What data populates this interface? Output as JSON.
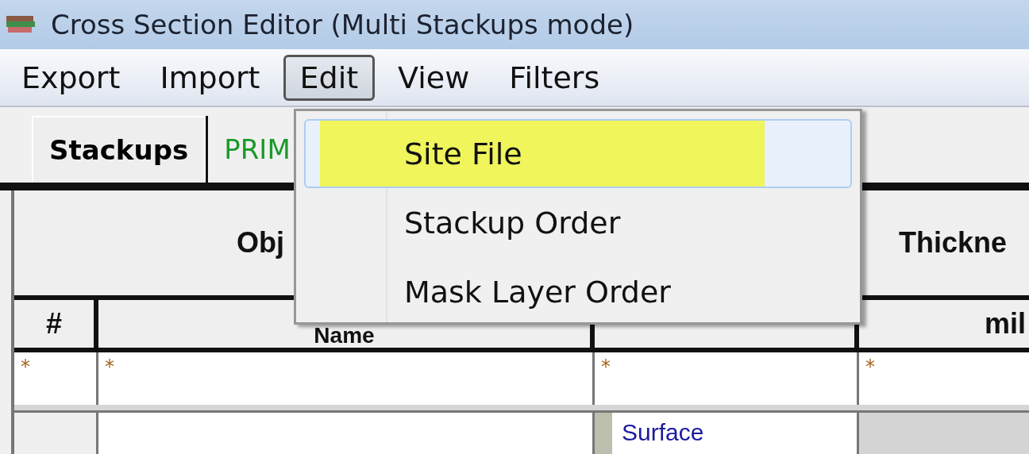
{
  "window": {
    "title": "Cross Section Editor (Multi Stackups mode)"
  },
  "menu_bar": [
    {
      "label": "Export",
      "selected": false
    },
    {
      "label": "Import",
      "selected": false
    },
    {
      "label": "Edit",
      "selected": true
    },
    {
      "label": "View",
      "selected": false
    },
    {
      "label": "Filters",
      "selected": false
    }
  ],
  "edit_menu": [
    {
      "label": "Site File",
      "selected": true
    },
    {
      "label": "Stackup Order",
      "selected": false
    },
    {
      "label": "Mask Layer Order",
      "selected": false
    }
  ],
  "tabs": [
    {
      "label": "Stackups",
      "selected": true
    },
    {
      "label": "PRIM",
      "selected": false
    }
  ],
  "table": {
    "group_headers": [
      "Obj",
      "Thickne"
    ],
    "column_1": "#",
    "column_2": "Name",
    "column_4": "mil",
    "filter_row": [
      "*",
      "*",
      "*",
      "*"
    ],
    "rows": [
      {
        "column_3": "Surface",
        "color": "#bcbfae"
      }
    ]
  }
}
